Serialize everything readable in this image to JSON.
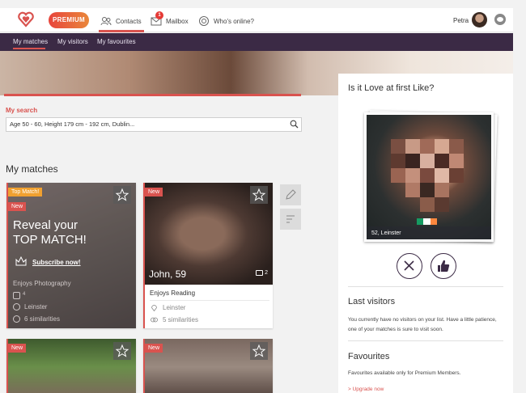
{
  "header": {
    "premium_label": "PREMIUM",
    "nav": {
      "contacts": "Contacts",
      "mailbox": "Mailbox",
      "whos_online": "Who's online?"
    },
    "mailbox_badge": "1",
    "user_name": "Petra"
  },
  "subnav": {
    "matches": "My matches",
    "visitors": "My visitors",
    "favourites": "My favourites"
  },
  "search": {
    "label": "My search",
    "value": "Age 50 - 60, Height 179 cm - 192 cm, Dublin..."
  },
  "matches": {
    "title": "My matches",
    "cards": [
      {
        "top_tag": "Top Match!",
        "new_tag": "New",
        "headline_line1": "Reveal your",
        "headline_line2": "TOP MATCH!",
        "cta": "Subscribe now!",
        "interest": "Enjoys Photography",
        "photos": "4",
        "location": "Leinster",
        "similarities": "6 similarities"
      },
      {
        "new_tag": "New",
        "name_age": "John, 59",
        "photos": "2",
        "interest": "Enjoys Reading",
        "location": "Leinster",
        "similarities": "5 similarities"
      },
      {
        "new_tag": "New"
      },
      {
        "new_tag": "New"
      }
    ]
  },
  "right_panel": {
    "love_title": "Is it Love at first Like?",
    "photo_caption": "52, Leinster",
    "last_visitors_title": "Last visitors",
    "last_visitors_text": "You currently have no visitors on your list. Have a little patience, one of your matches is sure to visit soon.",
    "favourites_title": "Favourites",
    "favourites_text": "Favourites available only for Premium Members.",
    "upgrade_link": "> Upgrade now"
  },
  "colors": {
    "accent": "#d9534f",
    "nav_dark": "#3b2a45",
    "top_match": "#f0a030"
  },
  "icons": [
    "logo-heart-icon",
    "contacts-icon",
    "mailbox-icon",
    "whos-online-icon",
    "eye-icon",
    "search-icon",
    "star-icon",
    "edit-icon",
    "sort-icon",
    "camera-icon",
    "location-icon",
    "similarities-icon",
    "close-icon",
    "thumbs-up-icon",
    "crown-icon"
  ]
}
